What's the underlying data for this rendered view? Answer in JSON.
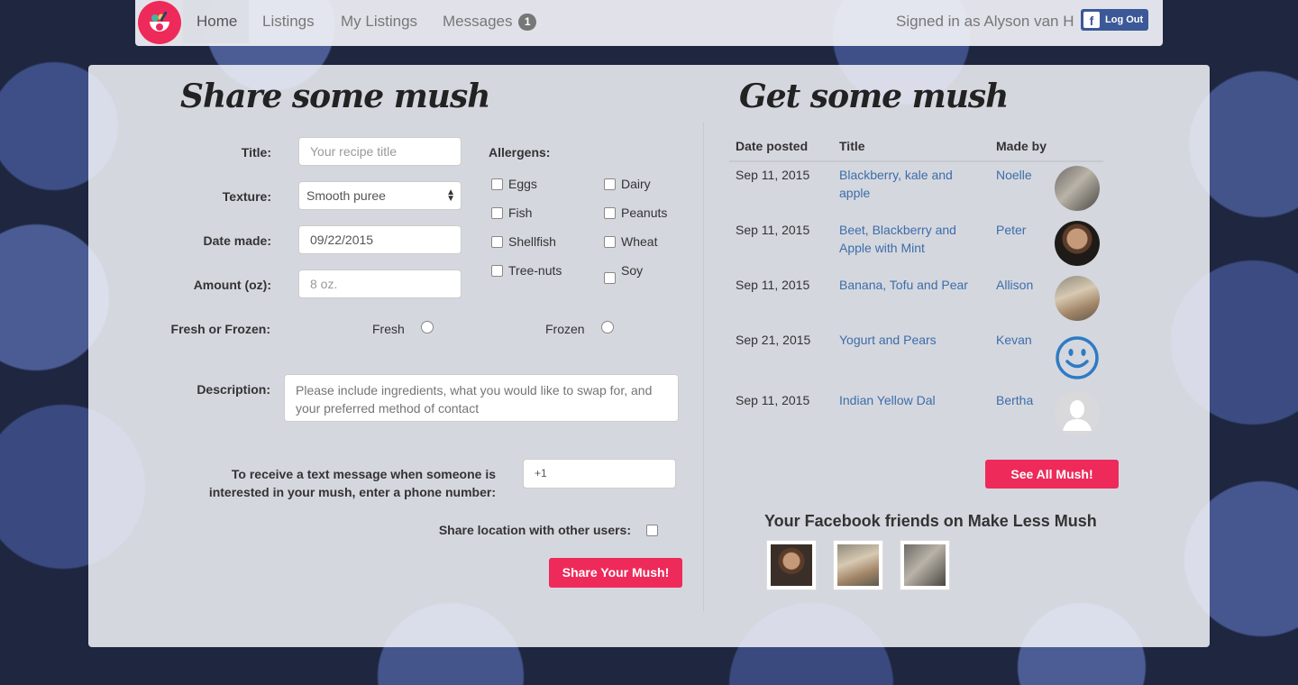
{
  "nav": {
    "items": [
      {
        "label": "Home",
        "active": true
      },
      {
        "label": "Listings"
      },
      {
        "label": "My Listings"
      },
      {
        "label": "Messages",
        "badge": "1"
      }
    ],
    "signed_in": "Signed in as Alyson van H",
    "logout_label": "Log Out"
  },
  "share": {
    "title": "Share some mush",
    "labels": {
      "title": "Title:",
      "texture": "Texture:",
      "date": "Date made:",
      "amount": "Amount (oz):",
      "fresh_frozen": "Fresh or Frozen:",
      "description": "Description:",
      "phone_1": "To receive a text message when someone is",
      "phone_2": "interested in your mush, enter a phone number:",
      "share_location": "Share location with other users:"
    },
    "title_placeholder": "Your recipe title",
    "texture_value": "Smooth puree",
    "date_value": "09/22/2015",
    "amount_placeholder": "8 oz.",
    "fresh_label": "Fresh",
    "frozen_label": "Frozen",
    "description_placeholder": "Please include ingredients, what you would like to swap for, and your preferred method of contact",
    "phone_value": "+1",
    "allergens_label": "Allergens:",
    "allergens": [
      "Eggs",
      "Dairy",
      "Fish",
      "Peanuts",
      "Shellfish",
      "Wheat",
      "Tree-nuts",
      "Soy"
    ],
    "submit_label": "Share Your Mush!"
  },
  "get": {
    "title": "Get some mush",
    "columns": [
      "Date posted",
      "Title",
      "Made by"
    ],
    "rows": [
      {
        "date": "Sep 11, 2015",
        "title_1": "Blackberry, kale and",
        "title_2": "apple",
        "maker": "Noelle",
        "avatar": "photo-avatar"
      },
      {
        "date": "Sep 11, 2015",
        "title_1": "Beet, Blackberry and",
        "title_2": "Apple with Mint",
        "maker": "Peter",
        "avatar": "photo-avatar"
      },
      {
        "date": "Sep 11, 2015",
        "title_1": "Banana, Tofu and Pear",
        "title_2": "",
        "maker": "Allison",
        "avatar": "photo-avatar"
      },
      {
        "date": "Sep 21, 2015",
        "title_1": "Yogurt and Pears",
        "title_2": "",
        "maker": "Kevan",
        "avatar": "smiley-icon"
      },
      {
        "date": "Sep 11, 2015",
        "title_1": "Indian Yellow Dal",
        "title_2": "",
        "maker": "Bertha",
        "avatar": "default-user-icon"
      }
    ],
    "see_all_label": "See All Mush!",
    "friends_title": "Your Facebook friends on Make Less Mush"
  },
  "colors": {
    "accent": "#ee2a5a",
    "link": "#3c6ea8",
    "facebook": "#3b5998"
  }
}
